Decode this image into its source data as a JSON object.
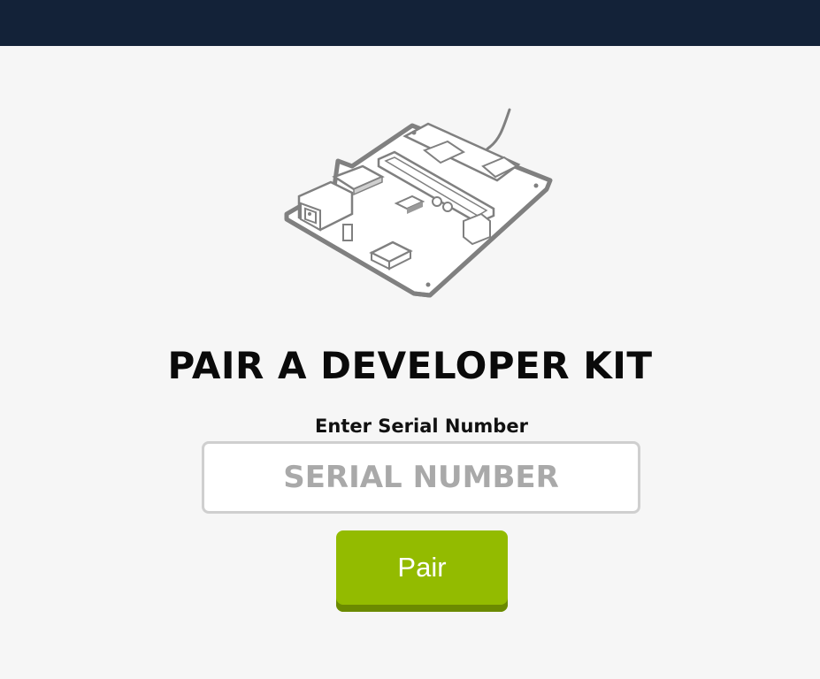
{
  "header": {
    "background_color": "#132238"
  },
  "illustration": {
    "icon": "developer-kit-board-icon"
  },
  "page": {
    "title": "PAIR A DEVELOPER KIT"
  },
  "serial_field": {
    "label": "Enter Serial Number",
    "placeholder": "SERIAL NUMBER",
    "value": ""
  },
  "pair_button": {
    "label": "Pair",
    "color": "#93bb00"
  }
}
